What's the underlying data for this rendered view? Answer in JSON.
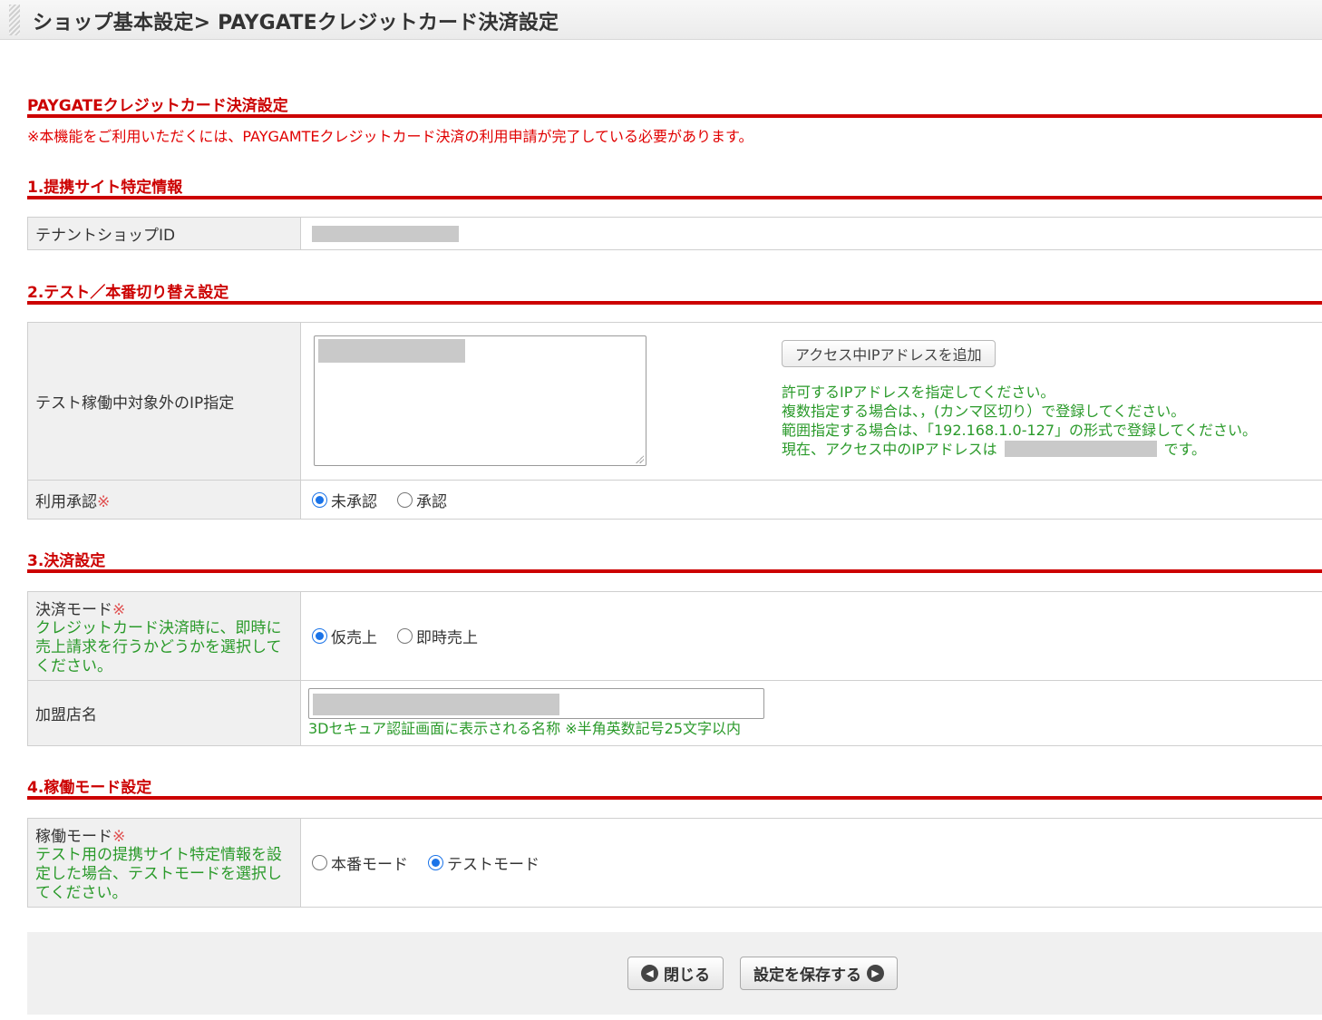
{
  "header": {
    "title": "ショップ基本設定> PAYGATEクレジットカード決済設定"
  },
  "main": {
    "heading": "PAYGATEクレジットカード決済設定",
    "notice": "※本機能をご利用いただくには、PAYGAMTEクレジットカード決済の利用申請が完了している必要があります。"
  },
  "sections": {
    "s1": {
      "title": "1.提携サイト特定情報",
      "tenant_label": "テナントショップID"
    },
    "s2": {
      "title": "2.テスト／本番切り替え設定",
      "ip_label": "テスト稼働中対象外のIP指定",
      "add_ip_button": "アクセス中IPアドレスを追加",
      "help_lines": [
        "許可するIPアドレスを指定してください。",
        "複数指定する場合は、，(カンマ区切り）で登録してください。",
        "範囲指定する場合は、「192.168.1.0-127」の形式で登録してください。"
      ],
      "current_ip_prefix": "現在、アクセス中のIPアドレスは",
      "current_ip_suffix": "です。",
      "approval_label": "利用承認",
      "approval_options": [
        "未承認",
        "承認"
      ],
      "approval_selected": "未承認"
    },
    "s3": {
      "title": "3.決済設定",
      "mode_label": "決済モード",
      "mode_help": "クレジットカード決済時に、即時に売上請求を行うかどうかを選択してください。",
      "mode_options": [
        "仮売上",
        "即時売上"
      ],
      "mode_selected": "仮売上",
      "merchant_label": "加盟店名",
      "merchant_help": "3Dセキュア認証画面に表示される名称 ※半角英数記号25文字以内"
    },
    "s4": {
      "title": "4.稼働モード設定",
      "op_label": "稼働モード",
      "op_help": "テスト用の提携サイト特定情報を設定した場合、テストモードを選択してください。",
      "op_options": [
        "本番モード",
        "テストモード"
      ],
      "op_selected": "テストモード"
    }
  },
  "required_mark": "※",
  "footer": {
    "close_label": "閉じる",
    "save_label": "設定を保存する"
  }
}
